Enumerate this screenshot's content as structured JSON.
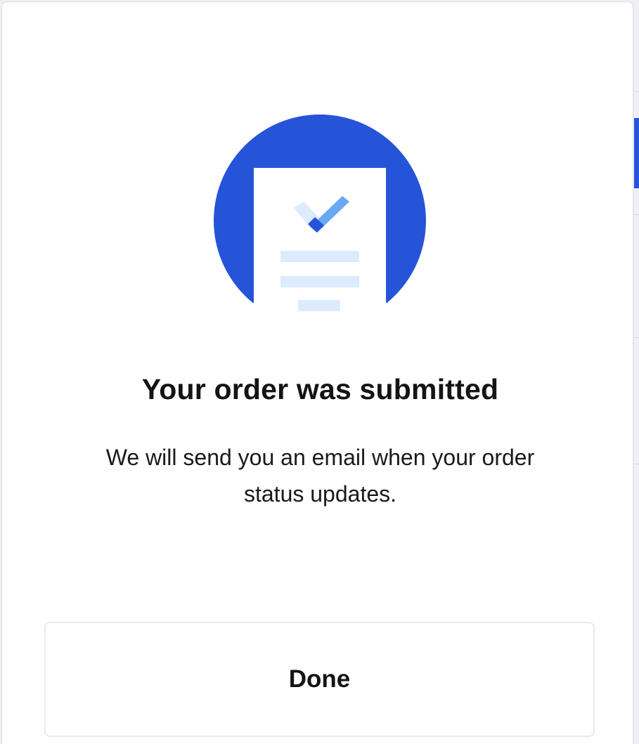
{
  "dialog": {
    "title": "Your order was submitted",
    "message": "We will send you an email when your order status updates.",
    "done_label": "Done"
  },
  "illustration": {
    "icon": "order-document-check-icon",
    "circle_color": "#2554d9",
    "check_light": "#69a8f3",
    "check_dark": "#2554d9",
    "line_color": "#dcebfd"
  }
}
